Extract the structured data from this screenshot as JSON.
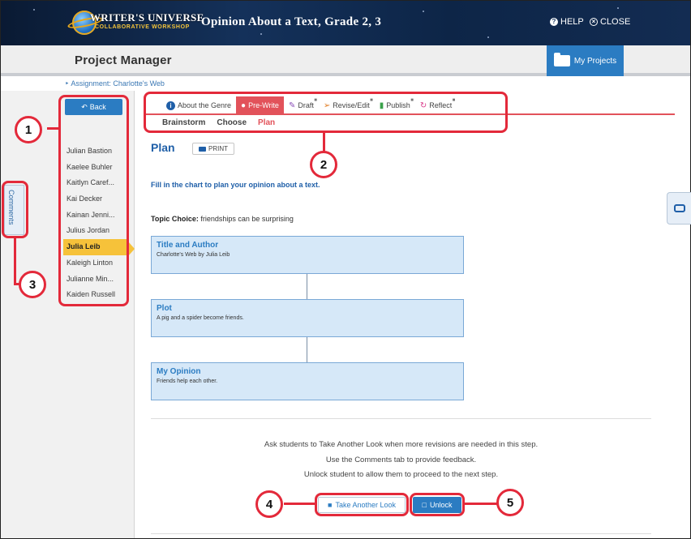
{
  "header": {
    "logo_line1": "WRITER'S UNIVERSE",
    "logo_line2": "COLLABORATIVE WORKSHOP",
    "title": "Opinion About a Text, Grade 2, 3",
    "help_label": "HELP",
    "close_label": "CLOSE"
  },
  "project_bar": {
    "title": "Project Manager",
    "my_projects_label": "My Projects"
  },
  "breadcrumb": "‣ Assignment: Charlotte's Web",
  "comments_tab": "Comments",
  "sidebar": {
    "back_label": "Back",
    "students": [
      "Julian Bastion",
      "Kaelee Buhler",
      "Kaitlyn Caref...",
      "Kai Decker",
      "Kainan Jenni...",
      "Julius Jordan",
      "Julia Leib",
      "Kaleigh Linton",
      "Julianne Min...",
      "Kaiden Russell"
    ],
    "active_student": "Julia Leib"
  },
  "steps": [
    {
      "label": "About the Genre",
      "icon": "info-icon",
      "active": false,
      "locked": false
    },
    {
      "label": "Pre-Write",
      "icon": "lightbulb-icon",
      "active": true,
      "locked": false
    },
    {
      "label": "Draft",
      "icon": "pencil-icon",
      "active": false,
      "locked": true
    },
    {
      "label": "Revise/Edit",
      "icon": "cursor-icon",
      "active": false,
      "locked": true
    },
    {
      "label": "Publish",
      "icon": "book-icon",
      "active": false,
      "locked": true
    },
    {
      "label": "Reflect",
      "icon": "refresh-icon",
      "active": false,
      "locked": true
    }
  ],
  "substeps": {
    "items": [
      "Brainstorm",
      "Choose",
      "Plan"
    ],
    "active": "Plan"
  },
  "plan": {
    "title": "Plan",
    "print_label": "PRINT",
    "instructions": "Fill in the chart to plan your opinion about a text.",
    "topic_label": "Topic Choice:",
    "topic_value": "friendships can be surprising",
    "cards": [
      {
        "title": "Title and Author",
        "text": "Charlotte's Web by Julia Leib"
      },
      {
        "title": "Plot",
        "text": "A pig and a spider become friends."
      },
      {
        "title": "My Opinion",
        "text": "Friends help each other."
      }
    ]
  },
  "notes": {
    "line1": "Ask students to Take Another Look when more revisions are needed in this step.",
    "line2": "Use the Comments tab to provide feedback.",
    "line3": "Unlock student to allow them to proceed to the next step."
  },
  "buttons": {
    "take_another_look": "Take Another Look",
    "unlock": "Unlock"
  },
  "callouts": [
    "1",
    "2",
    "3",
    "4",
    "5"
  ],
  "colors": {
    "accent": "#2b7cc2",
    "active_step": "#e2525a",
    "highlight": "#e3293a",
    "active_student": "#f6c23a"
  }
}
